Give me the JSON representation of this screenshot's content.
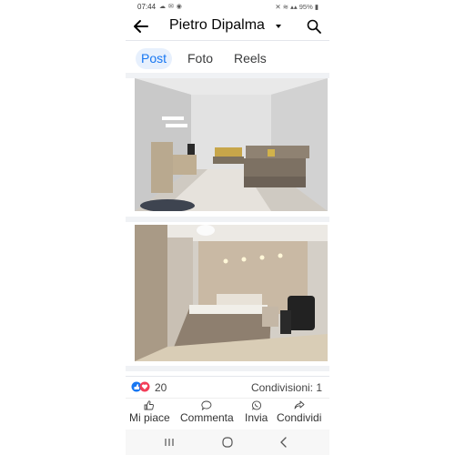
{
  "status": {
    "time": "07:44",
    "battery": "95%"
  },
  "header": {
    "title": "Pietro Dipalma"
  },
  "tabs": [
    {
      "label": "Post"
    },
    {
      "label": "Foto"
    },
    {
      "label": "Reels"
    }
  ],
  "post": {
    "reactions_count": "20",
    "shares": "Condivisioni: 1"
  },
  "actions": {
    "like": "Mi piace",
    "comment": "Commenta",
    "send": "Invia",
    "share": "Condividi"
  },
  "colors": {
    "accent": "#1877f2",
    "love": "#f33e58"
  },
  "icons": [
    "back-arrow-icon",
    "search-icon",
    "like-icon",
    "comment-icon",
    "whatsapp-icon",
    "share-icon",
    "recents-icon",
    "home-icon",
    "back-nav-icon"
  ]
}
